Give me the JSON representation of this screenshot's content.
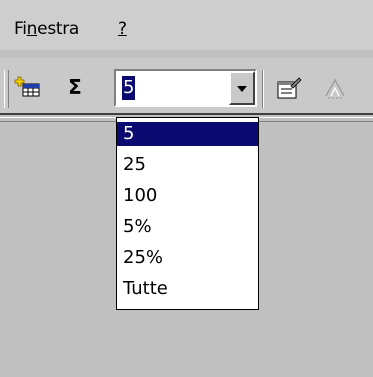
{
  "menubar": {
    "items": [
      {
        "label_pre": "Fi",
        "accel": "n",
        "label_post": "estra"
      },
      {
        "label_pre": "",
        "accel": "?",
        "label_post": ""
      }
    ]
  },
  "toolbar": {
    "icons": [
      "new-table-icon",
      "sigma-icon",
      "properties-icon",
      "build-icon"
    ],
    "sigma_glyph": "Σ",
    "combo": {
      "value": "5"
    }
  },
  "dropdown": {
    "options": [
      "5",
      "25",
      "100",
      "5%",
      "25%",
      "Tutte"
    ],
    "selected_index": 0
  },
  "colors": {
    "selection": "#0a0a70",
    "face": "#c0c0c0"
  }
}
